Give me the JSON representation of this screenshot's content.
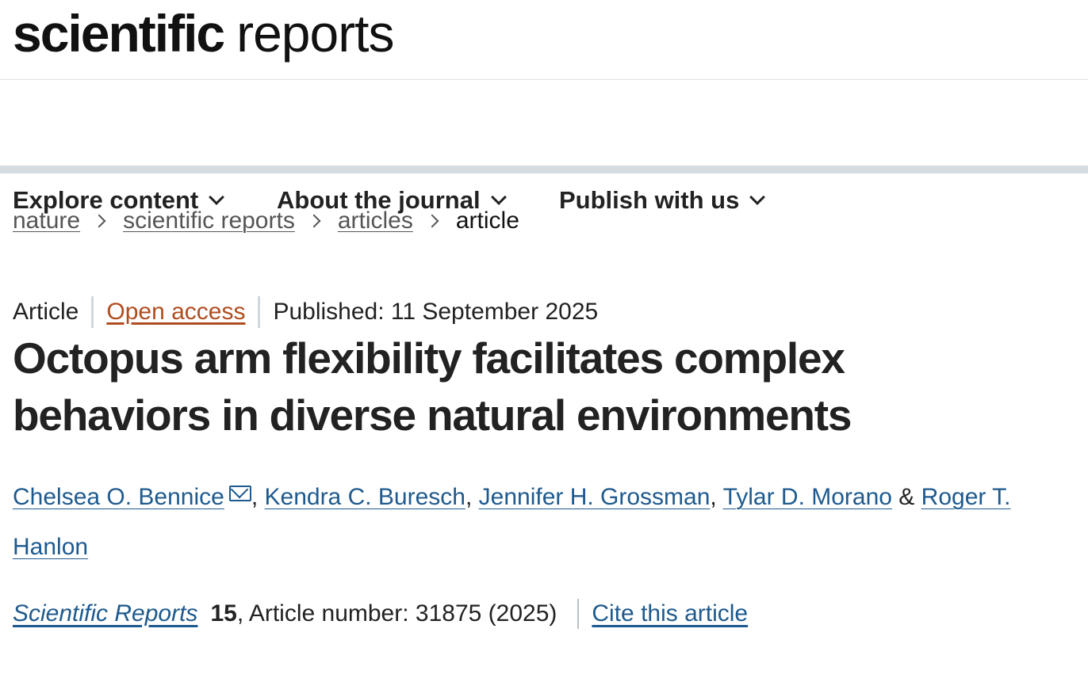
{
  "header": {
    "logo_bold": "scientific",
    "logo_light": "reports"
  },
  "nav": {
    "items": [
      {
        "label": "Explore content"
      },
      {
        "label": "About the journal"
      },
      {
        "label": "Publish with us"
      }
    ]
  },
  "breadcrumb": {
    "items": [
      "nature",
      "scientific reports",
      "articles"
    ],
    "current": "article"
  },
  "meta": {
    "type": "Article",
    "access": "Open access",
    "published": "Published: 11 September 2025"
  },
  "title": "Octopus arm flexibility facilitates complex behaviors in diverse natural environments",
  "authors": {
    "list": [
      "Chelsea O. Bennice",
      "Kendra C. Buresch",
      "Jennifer H. Grossman",
      "Tylar D. Morano",
      "Roger T. Hanlon"
    ],
    "separator": ", ",
    "last_separator": " & "
  },
  "citation": {
    "journal": "Scientific Reports",
    "volume": "15",
    "details": ", Article number: 31875 (2025)",
    "cite_link": "Cite this article"
  },
  "colors": {
    "link": "#1e5a8e",
    "open_access": "#b04d1f",
    "nav_bar_border": "#d5dde3"
  }
}
